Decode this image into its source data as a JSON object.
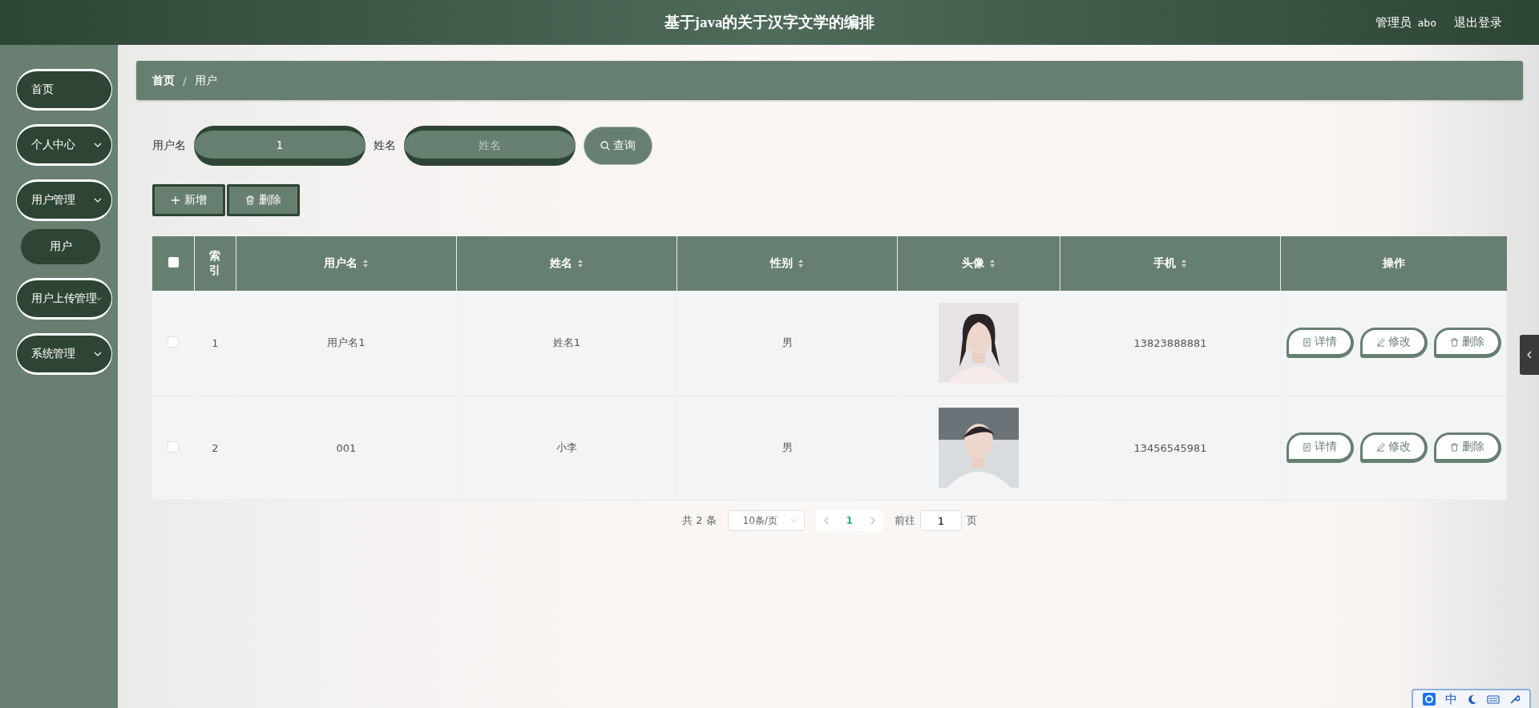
{
  "header": {
    "title": "基于java的关于汉字文学的编排",
    "user_role": "管理员",
    "user_name": "abo",
    "logout": "退出登录"
  },
  "sidebar": {
    "items": [
      {
        "kind": "link",
        "label": "首页"
      },
      {
        "kind": "menu",
        "label": "个人中心"
      },
      {
        "kind": "menu",
        "label": "用户管理",
        "children": [
          {
            "label": "用户"
          }
        ]
      },
      {
        "kind": "menu",
        "label": "用户上传管理"
      },
      {
        "kind": "menu",
        "label": "系统管理"
      }
    ]
  },
  "breadcrumb": {
    "separator": "/",
    "items": [
      "首页",
      "用户"
    ]
  },
  "search": {
    "fields": [
      {
        "label": "用户名",
        "value": "1"
      },
      {
        "label": "姓名",
        "placeholder": "姓名"
      }
    ],
    "button": "查询"
  },
  "actions": [
    {
      "kind": "add",
      "label": "新增"
    },
    {
      "kind": "delete",
      "label": "删除"
    }
  ],
  "table": {
    "select_all_checked": false,
    "columns": [
      {
        "label": "索引",
        "sortable": false
      },
      {
        "label": "用户名",
        "sortable": true
      },
      {
        "label": "姓名",
        "sortable": true
      },
      {
        "label": "性别",
        "sortable": true
      },
      {
        "label": "头像",
        "sortable": true
      },
      {
        "label": "手机",
        "sortable": true
      },
      {
        "label": "操作",
        "sortable": false
      }
    ],
    "rows": [
      {
        "checked": false,
        "index": "1",
        "username": "用户名1",
        "name": "姓名1",
        "gender": "男",
        "phone": "13823888881",
        "actions": [
          {
            "kind": "detail",
            "label": "详情"
          },
          {
            "kind": "edit",
            "label": "修改"
          },
          {
            "kind": "delete",
            "label": "删除"
          }
        ]
      },
      {
        "checked": false,
        "index": "2",
        "username": "001",
        "name": "小李",
        "gender": "男",
        "phone": "13456545981",
        "actions": [
          {
            "kind": "detail",
            "label": "详情"
          },
          {
            "kind": "edit",
            "label": "修改"
          },
          {
            "kind": "delete",
            "label": "删除"
          }
        ]
      }
    ]
  },
  "pagination": {
    "total": "共 2 条",
    "page_size": "10条/页",
    "pages": [
      {
        "label": "1",
        "selected": true
      }
    ],
    "goto_label": "前往",
    "goto_value": "1",
    "goto_suffix": "页"
  },
  "ime_toolbar": {
    "label": "中"
  }
}
